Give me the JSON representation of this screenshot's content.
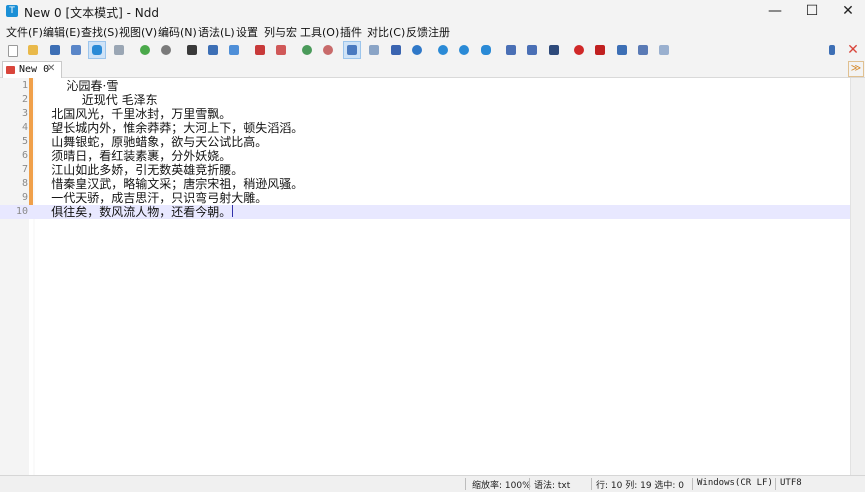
{
  "titlebar": {
    "title": "New 0 [文本模式] - Ndd",
    "app_icon": "T",
    "minimize": "—",
    "maximize": "☐",
    "close": "✕"
  },
  "menu": [
    "文件(F)",
    "编辑(E)",
    "查找(S)",
    "视图(V)",
    "编码(N)",
    "语法(L)",
    "设置",
    "列与宏",
    "工具(O)",
    "插件",
    "对比(C)",
    "反馈注册"
  ],
  "tab": {
    "label": "New 0",
    "close": "✕",
    "dropdown": "≫"
  },
  "editor": {
    "lines": [
      "        沁园春·雪",
      "            近现代 毛泽东",
      "    北国风光，千里冰封，万里雪飘。",
      "    望长城内外，惟余莽莽；大河上下，顿失滔滔。",
      "    山舞银蛇，原驰蜡象，欲与天公试比高。",
      "    须晴日，看红装素裹，分外妖娆。",
      "    江山如此多娇，引无数英雄竞折腰。",
      "    惜秦皇汉武，略输文采；唐宗宋祖，稍逊风骚。",
      "    一代天骄，成吉思汗，只识弯弓射大雕。",
      "    俱往矣，数风流人物，还看今朝。"
    ],
    "current_line": 10
  },
  "status": {
    "zoom": "缩放率: 100%",
    "syntax": "语法: txt",
    "position": "行: 10  列: 19  选中: 0",
    "eol": "Windows(CR LF)",
    "encoding": "UTF8"
  },
  "toolbar_icons": [
    "new-file-icon",
    "open-file-icon",
    "save-icon",
    "save-all-icon",
    "file-mode-icon",
    "close-file-icon",
    "undo-icon",
    "redo-icon",
    "find-icon",
    "replace-icon",
    "go-to-line-icon",
    "mark-icon",
    "clear-mark-icon",
    "zoom-in-icon",
    "zoom-out-icon",
    "word-wrap-icon",
    "show-symbols-icon",
    "indent-guide-icon",
    "highlight-icon",
    "prev-bookmark-icon",
    "next-bookmark-icon",
    "bookmark-pair-icon",
    "split-view-icon",
    "column-view-icon",
    "monitor-icon",
    "macro-record-icon",
    "macro-stop-icon",
    "macro-play-icon",
    "macro-save-icon",
    "macro-run-icon",
    "pin-icon",
    "close-all-icon"
  ],
  "colors": {
    "accent": "#1a8fd6",
    "modified": "#f0a04a",
    "current_line": "#e8e8ff",
    "close_red": "#d9453b"
  }
}
